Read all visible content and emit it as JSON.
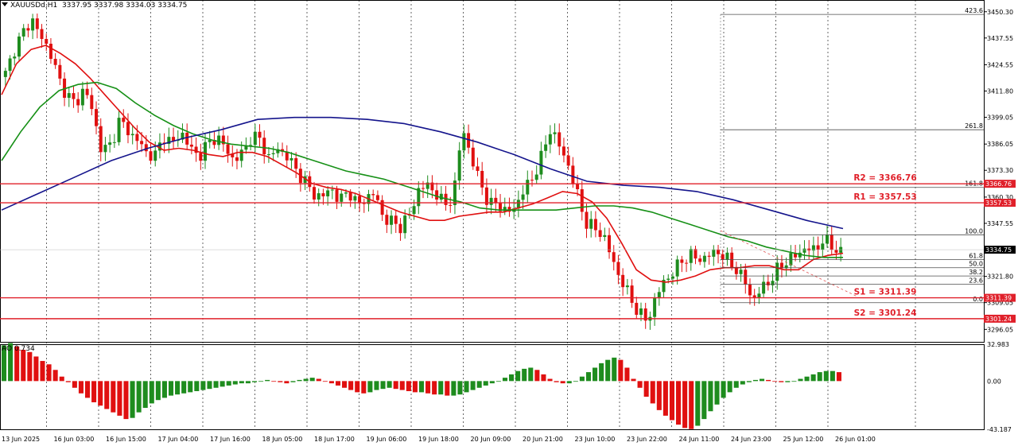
{
  "header": {
    "symbol": "XAUUSDd,H1",
    "ohlc": "3337.95 3337.98 3334.03 3334.75"
  },
  "indicator": {
    "label": "AO 0.734"
  },
  "colors": {
    "bull": "#1e8c1e",
    "bear": "#e01010",
    "ma_fast": "#e01010",
    "ma_mid": "#169016",
    "ma_slow": "#14148c",
    "level_line": "#e0202a",
    "fib_line": "#4d4d4d",
    "grid": "#000000"
  },
  "chart_data": [
    {
      "type": "candlestick",
      "title": "XAUUSDd,H1",
      "ylim": [
        3290,
        3456
      ],
      "y_ticks": [
        3450.3,
        3437.55,
        3424.55,
        3411.8,
        3399.05,
        3386.05,
        3373.3,
        3360.3,
        3347.55,
        3334.55,
        3321.8,
        3309.05,
        3296.05
      ],
      "x_tick_labels": [
        "13 Jun 2025",
        "16 Jun 03:00",
        "16 Jun 15:00",
        "17 Jun 04:00",
        "17 Jun 16:00",
        "18 Jun 05:00",
        "18 Jun 17:00",
        "19 Jun 06:00",
        "19 Jun 18:00",
        "20 Jun 09:00",
        "20 Jun 21:00",
        "23 Jun 10:00",
        "23 Jun 22:00",
        "24 Jun 11:00",
        "24 Jun 23:00",
        "25 Jun 12:00",
        "26 Jun 01:00"
      ],
      "current_price": "3334.75",
      "price_path": [
        3420,
        3432,
        3440,
        3447,
        3438,
        3432,
        3418,
        3410,
        3405,
        3414,
        3400,
        3382,
        3386,
        3398,
        3392,
        3388,
        3382,
        3380,
        3390,
        3386,
        3392,
        3384,
        3380,
        3386,
        3390,
        3384,
        3378,
        3382,
        3390,
        3388,
        3379,
        3384,
        3380,
        3374,
        3368,
        3362,
        3360,
        3365,
        3358,
        3364,
        3356,
        3360,
        3362,
        3350,
        3348,
        3346,
        3352,
        3364,
        3366,
        3362,
        3356,
        3362,
        3395,
        3378,
        3368,
        3356,
        3358,
        3352,
        3356,
        3364,
        3370,
        3380,
        3394,
        3385,
        3376,
        3362,
        3348,
        3345,
        3342,
        3330,
        3320,
        3312,
        3304,
        3300,
        3312,
        3320,
        3324,
        3330,
        3332,
        3330,
        3332,
        3334,
        3330,
        3326,
        3320,
        3310,
        3316,
        3320,
        3326,
        3330,
        3332,
        3336,
        3334,
        3340,
        3336,
        3334
      ],
      "moving_averages": [
        {
          "color": "red",
          "values": [
            3410,
            3425,
            3432,
            3434,
            3430,
            3425,
            3418,
            3410,
            3402,
            3394,
            3387,
            3383,
            3384,
            3383,
            3381,
            3380,
            3382,
            3382,
            3380,
            3376,
            3372,
            3367,
            3365,
            3364,
            3362,
            3359,
            3356,
            3353,
            3351,
            3349,
            3349,
            3351,
            3352,
            3353,
            3353,
            3355,
            3357,
            3360,
            3363,
            3362,
            3358,
            3350,
            3338,
            3325,
            3320,
            3319,
            3320,
            3322,
            3325,
            3326,
            3326,
            3327,
            3327,
            3325,
            3325,
            3330,
            3332,
            3333
          ]
        },
        {
          "color": "green",
          "values": [
            3378,
            3392,
            3404,
            3412,
            3415,
            3416,
            3413,
            3406,
            3400,
            3395,
            3391,
            3388,
            3386,
            3385,
            3384,
            3382,
            3379,
            3376,
            3373,
            3371,
            3369,
            3366,
            3363,
            3360,
            3358,
            3355,
            3354,
            3354,
            3354,
            3354,
            3355,
            3356,
            3356,
            3355,
            3353,
            3350,
            3347,
            3344,
            3341,
            3339,
            3336,
            3334,
            3332,
            3331,
            3331
          ]
        },
        {
          "color": "navy",
          "values": [
            3354,
            3362,
            3370,
            3378,
            3384,
            3389,
            3393,
            3398,
            3399,
            3399,
            3398,
            3396,
            3392,
            3387,
            3381,
            3374,
            3368,
            3366,
            3365,
            3363,
            3359,
            3354,
            3349,
            3345
          ]
        }
      ],
      "horizontal_levels": [
        {
          "label": "R2 = 3366.76",
          "price": 3366.76,
          "tag": "3366.76"
        },
        {
          "label": "R1 = 3357.53",
          "price": 3357.53,
          "tag": "3357.53"
        },
        {
          "label": "S1 = 3311.39",
          "price": 3311.39,
          "tag": "3311.39"
        },
        {
          "label": "S2 = 3301.24",
          "price": 3301.24,
          "tag": "3301.24"
        }
      ],
      "fibonacci_levels": [
        {
          "label": "423.6",
          "price": 3449
        },
        {
          "label": "261.8",
          "price": 3393
        },
        {
          "label": "161.8",
          "price": 3365
        },
        {
          "label": "100.0",
          "price": 3342
        },
        {
          "label": "61.8",
          "price": 3330
        },
        {
          "label": "50.0",
          "price": 3326
        },
        {
          "label": "38.2",
          "price": 3322
        },
        {
          "label": "23.6",
          "price": 3318
        },
        {
          "label": "0.0",
          "price": 3309
        }
      ]
    },
    {
      "type": "bar",
      "title": "AO 0.734",
      "ylim": [
        -43.187,
        32.983
      ],
      "y_ticks": [
        "32.983",
        "0.00",
        "-43.187"
      ],
      "values": [
        32,
        34,
        31,
        28,
        26,
        22,
        18,
        15,
        10,
        4,
        -1,
        -6,
        -11,
        -15,
        -19,
        -22,
        -25,
        -28,
        -31,
        -34,
        -33,
        -28,
        -24,
        -20,
        -17,
        -15,
        -13,
        -12,
        -11,
        -10,
        -9,
        -8,
        -7,
        -6,
        -5,
        -4,
        -3,
        -2,
        -2,
        -1,
        0,
        1,
        0,
        -1,
        -2,
        -1,
        1,
        2,
        3,
        2,
        0,
        -2,
        -4,
        -6,
        -8,
        -10,
        -11,
        -10,
        -8,
        -7,
        -6,
        -7,
        -8,
        -9,
        -10,
        -10,
        -11,
        -12,
        -12,
        -13,
        -13,
        -12,
        -10,
        -8,
        -6,
        -4,
        -2,
        0,
        3,
        6,
        9,
        11,
        12,
        10,
        6,
        2,
        -1,
        -2,
        -2,
        0,
        4,
        8,
        12,
        16,
        19,
        21,
        19,
        12,
        2,
        -6,
        -14,
        -20,
        -26,
        -31,
        -35,
        -39,
        -42,
        -43,
        -40,
        -34,
        -27,
        -21,
        -15,
        -10,
        -6,
        -3,
        -1,
        1,
        2,
        1,
        0,
        -1,
        -1,
        0,
        2,
        4,
        6,
        8,
        9,
        9,
        8
      ]
    }
  ]
}
